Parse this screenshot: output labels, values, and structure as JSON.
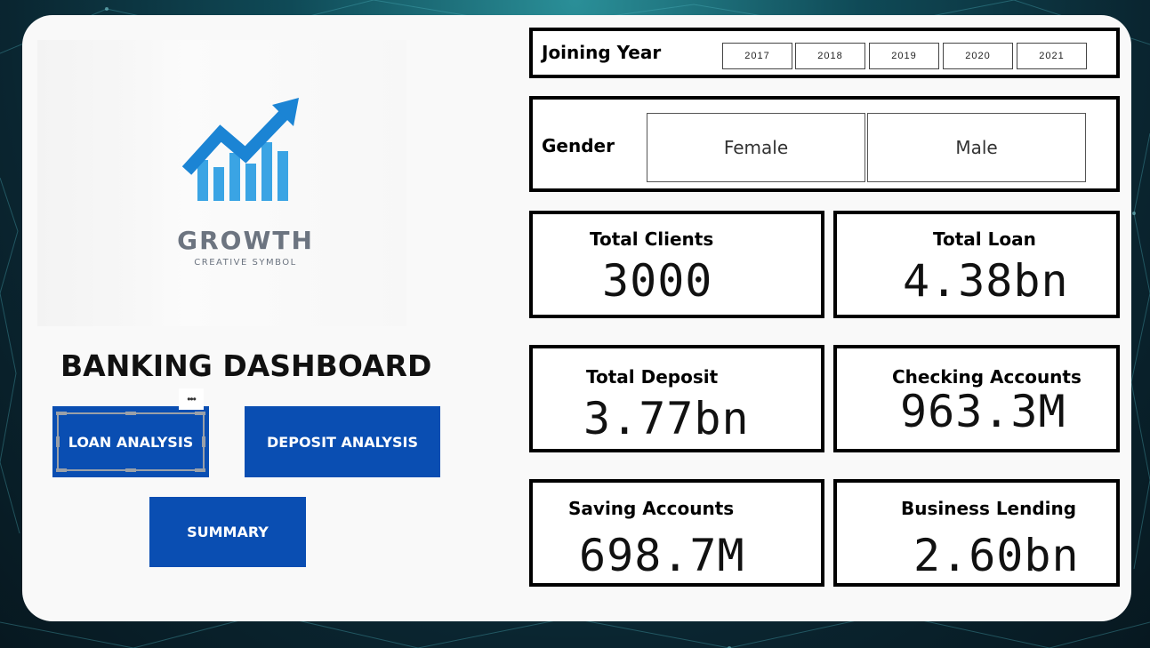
{
  "colors": {
    "accent": "#0a4eb2",
    "panel": "#f9f9f9",
    "border": "#000000"
  },
  "logo": {
    "wordmark": "GROWTH",
    "tagline": "CREATIVE SYMBOL",
    "icon": "growth-arrow-icon"
  },
  "dashboard": {
    "title": "BANKING DASHBOARD"
  },
  "nav": {
    "loan_label": "LOAN ANALYSIS",
    "deposit_label": "DEPOSIT ANALYSIS",
    "summary_label": "SUMMARY",
    "more_label": "•••"
  },
  "filters": {
    "joining_year": {
      "label": "Joining Year",
      "options": [
        "2017",
        "2018",
        "2019",
        "2020",
        "2021"
      ]
    },
    "gender": {
      "label": "Gender",
      "options": [
        "Female",
        "Male"
      ]
    }
  },
  "kpis": [
    {
      "label": "Total Clients",
      "value": "3000"
    },
    {
      "label": "Total Loan",
      "value": "4.38bn"
    },
    {
      "label": "Total Deposit",
      "value": "3.77bn"
    },
    {
      "label": "Checking Accounts",
      "value": "963.3M"
    },
    {
      "label": "Saving Accounts",
      "value": "698.7M"
    },
    {
      "label": "Business Lending",
      "value": "2.60bn"
    }
  ]
}
